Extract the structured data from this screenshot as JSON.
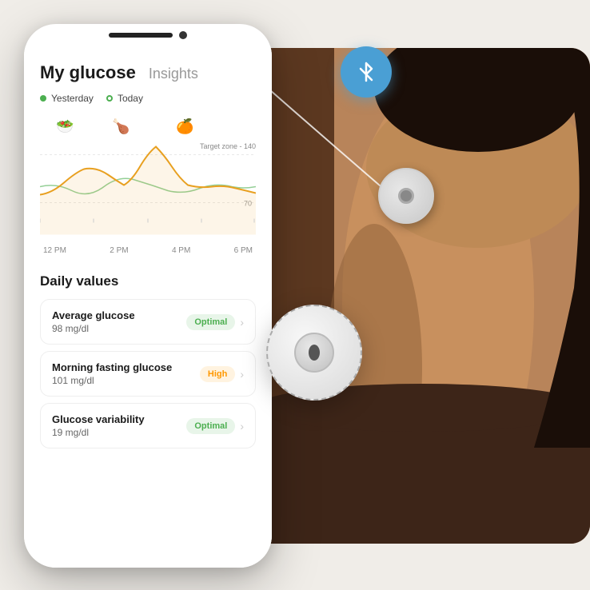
{
  "header": {
    "title": "My glucose",
    "tab_inactive": "Insights"
  },
  "legend": {
    "yesterday_label": "Yesterday",
    "today_label": "Today",
    "yesterday_color": "#4caf50",
    "today_color": "#4caf50"
  },
  "chart": {
    "target_zone_label": "Target zone - 140",
    "y_label_70": "70",
    "x_labels": [
      "12 PM",
      "2 PM",
      "4 PM",
      "6 PM"
    ],
    "food_icons": [
      "🥗",
      "🍗",
      "🍊"
    ]
  },
  "daily_values": {
    "section_title": "Daily values",
    "metrics": [
      {
        "name": "Average glucose",
        "value": "98 mg/dl",
        "badge": "Optimal",
        "badge_type": "optimal"
      },
      {
        "name": "Morning fasting glucose",
        "value": "101 mg/dl",
        "badge": "High",
        "badge_type": "high"
      },
      {
        "name": "Glucose variability",
        "value": "19 mg/dl",
        "badge": "Optimal",
        "badge_type": "optimal"
      }
    ]
  },
  "bluetooth": {
    "label": "Bluetooth",
    "color": "#4a9fd4"
  },
  "icons": {
    "bluetooth": "ᛒ"
  }
}
